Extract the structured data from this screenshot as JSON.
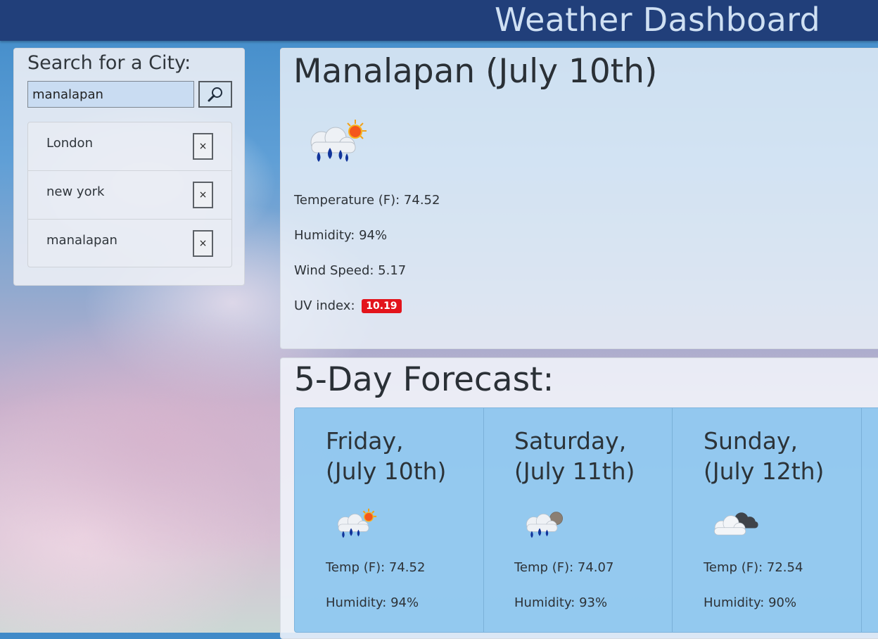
{
  "header": {
    "title": "Weather Dashboard"
  },
  "sidebar": {
    "label": "Search for a City:",
    "search": {
      "value": "manalapan",
      "placeholder": ""
    },
    "cities": [
      {
        "name": "London",
        "remove_label": "×"
      },
      {
        "name": "new york",
        "remove_label": "×"
      },
      {
        "name": "manalapan",
        "remove_label": "×"
      }
    ]
  },
  "current": {
    "title": "Manalapan (July 10th)",
    "icon": "rain-sun-icon",
    "temperature": "Temperature (F): 74.52",
    "humidity": "Humidity: 94%",
    "wind": "Wind Speed: 5.17",
    "uv_label": "UV index:",
    "uv_value": "10.19",
    "uv_color": "#e3141c"
  },
  "forecast": {
    "title": "5-Day Forecast:",
    "days": [
      {
        "day": "Friday,\n(July 10th)",
        "icon": "rain-sun-icon",
        "temp": "Temp (F): 74.52",
        "humidity": "Humidity: 94%"
      },
      {
        "day": "Saturday,\n(July 11th)",
        "icon": "rain-cloudy-icon",
        "temp": "Temp (F): 74.07",
        "humidity": "Humidity: 93%"
      },
      {
        "day": "Sunday,\n(July 12th)",
        "icon": "cloudy-icon",
        "temp": "Temp (F): 72.54",
        "humidity": "Humidity: 90%"
      }
    ]
  }
}
